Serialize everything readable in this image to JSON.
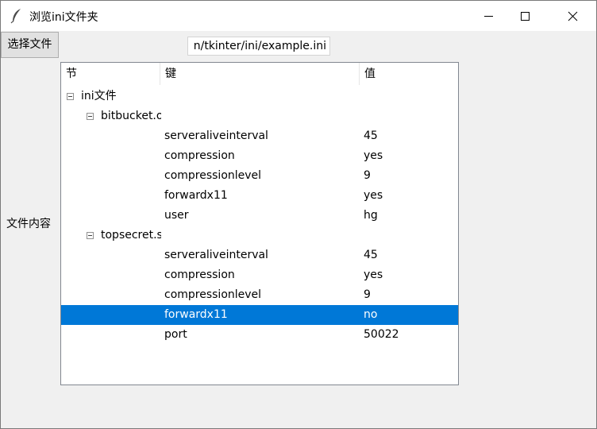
{
  "window": {
    "title": "浏览ini文件夹"
  },
  "toolbar": {
    "choose_button": "选择文件",
    "path_value": "n/tkinter/ini/example.ini"
  },
  "side_label": "文件内容",
  "tree": {
    "columns": [
      "节",
      "键",
      "值"
    ],
    "root": "ini文件",
    "sections": [
      {
        "name": "bitbucket.o",
        "items": [
          {
            "key": "serveraliveinterval",
            "value": "45"
          },
          {
            "key": "compression",
            "value": "yes"
          },
          {
            "key": "compressionlevel",
            "value": "9"
          },
          {
            "key": "forwardx11",
            "value": "yes"
          },
          {
            "key": "user",
            "value": "hg"
          }
        ]
      },
      {
        "name": "topsecret.s",
        "items": [
          {
            "key": "serveraliveinterval",
            "value": "45"
          },
          {
            "key": "compression",
            "value": "yes"
          },
          {
            "key": "compressionlevel",
            "value": "9"
          },
          {
            "key": "forwardx11",
            "value": "no",
            "selected": true
          },
          {
            "key": "port",
            "value": "50022"
          }
        ]
      }
    ]
  },
  "colors": {
    "selection": "#0078d7",
    "window_bg": "#f0f0f0"
  }
}
